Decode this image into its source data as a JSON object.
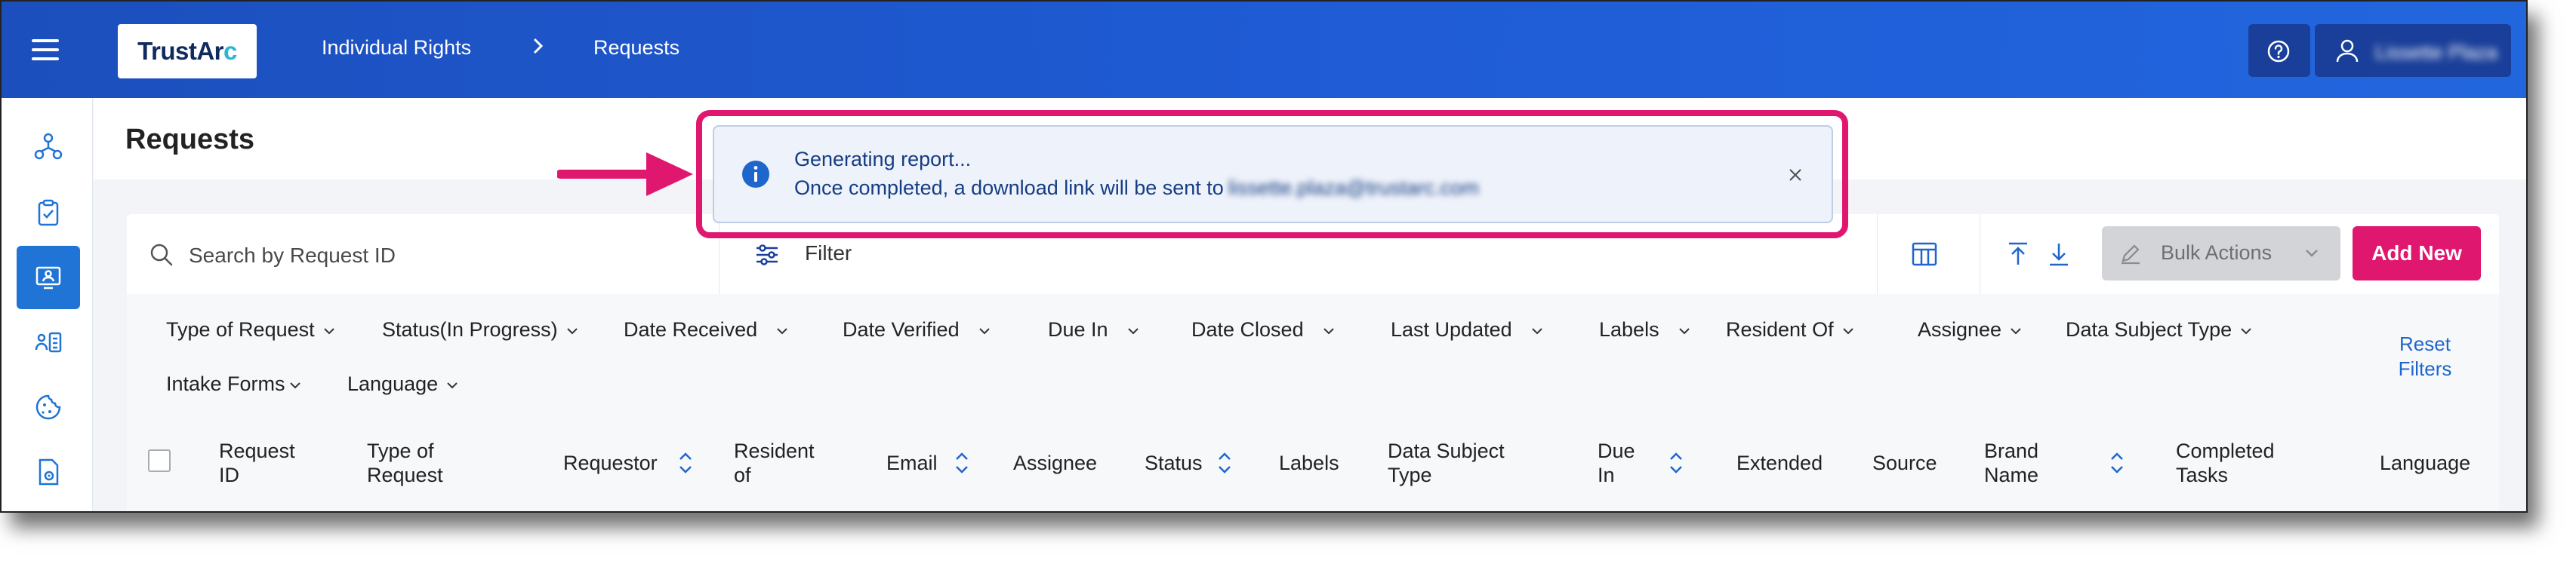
{
  "app": {
    "logo_text_1": "TrustAr",
    "logo_text_2": "c",
    "breadcrumb": [
      "Individual Rights",
      "Requests"
    ],
    "user_name": "Lissette Plaza"
  },
  "page": {
    "title": "Requests"
  },
  "toolbar": {
    "search_placeholder": "Search by Request ID",
    "filter_label": "Filter",
    "bulk_actions_label": "Bulk Actions",
    "add_new_label": "Add New"
  },
  "filters": {
    "chips": [
      "Type of Request",
      "Status(In Progress)",
      "Date Received",
      "Date Verified",
      "Due In",
      "Date Closed",
      "Last Updated",
      "Labels",
      "Resident Of",
      "Assignee",
      "Data Subject Type",
      "Intake Forms",
      "Language"
    ],
    "reset_label_1": "Reset",
    "reset_label_2": "Filters"
  },
  "table": {
    "columns": [
      [
        "Request",
        "ID"
      ],
      [
        "Type of",
        "Request"
      ],
      [
        "Requestor",
        ""
      ],
      [
        "Resident",
        "of"
      ],
      [
        "Email",
        ""
      ],
      [
        "Assignee",
        ""
      ],
      [
        "Status",
        ""
      ],
      [
        "Labels",
        ""
      ],
      [
        "Data Subject",
        "Type"
      ],
      [
        "Due",
        "In"
      ],
      [
        "Extended",
        ""
      ],
      [
        "Source",
        ""
      ],
      [
        "Brand",
        "Name"
      ],
      [
        "Completed",
        "Tasks"
      ],
      [
        "Language",
        ""
      ]
    ]
  },
  "toast": {
    "title": "Generating report...",
    "message": "Once completed, a download link will be sent to",
    "email": "lissette.plaza@trustarc.com"
  },
  "colors": {
    "header_blue": "#1f5cd6",
    "accent_pink": "#e0176f",
    "link_blue": "#1f66cc"
  }
}
